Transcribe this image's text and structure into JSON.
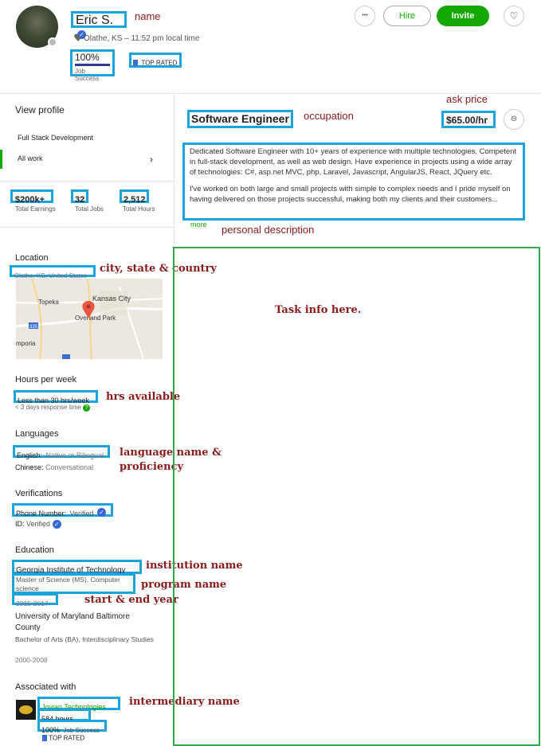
{
  "profile": {
    "name": "Eric S.",
    "location_time": "Olathe, KS – 11:52 pm local time",
    "job_success_value": "100%",
    "job_success_label": "Job Success",
    "job_success_fraction": 1.0,
    "badge": "TOP RATED"
  },
  "actions": {
    "more": "•••",
    "hire": "Hire",
    "invite": "Invite"
  },
  "sidebar": {
    "view_profile": "View profile",
    "specialty": "Full Stack Development",
    "all_work": "All work",
    "stats": [
      {
        "value": "$200k+",
        "label": "Total Earnings"
      },
      {
        "value": "32",
        "label": "Total Jobs"
      },
      {
        "value": "2,512",
        "label": "Total Hours"
      }
    ],
    "location_title": "Location",
    "location_value": "Olathe, KS, United States",
    "map_labels": {
      "kansas_city": "Kansas City",
      "topeka": "Topeka",
      "overland_park": "Overland Park",
      "emporia": "mporia",
      "r335": "335",
      "r35": "35"
    },
    "hours_title": "Hours per week",
    "hours_value": "Less than 30 hrs/week",
    "response_time": "< 3 days response time",
    "languages_title": "Languages",
    "languages": [
      {
        "name": "English:",
        "level": "Native or Bilingual"
      },
      {
        "name": "Chinese:",
        "level": "Conversational"
      }
    ],
    "verifications_title": "Verifications",
    "verifications": [
      {
        "name": "Phone Number:",
        "status": "Verified"
      },
      {
        "name": "ID:",
        "status": "Verified"
      }
    ],
    "education_title": "Education",
    "education": [
      {
        "institution": "Georgia Institute of Technology",
        "program": "Master of Science (MS), Computer science",
        "years": "2015-2017"
      },
      {
        "institution": "University of Maryland Baltimore County",
        "program": "Bachelor of Arts (BA), Interdisciplinary Studies",
        "years": "2000-2008"
      }
    ],
    "associated_title": "Associated with",
    "agency": {
      "name": "Jovian Technologies",
      "hours": "584 hours",
      "success_value": "100%",
      "success_label": "Job Success",
      "badge": "TOP RATED"
    }
  },
  "main": {
    "occupation": "Software Engineer",
    "rate": "$65.00/hr",
    "description_p1": "Dedicated Software Engineer with 10+ years of experience with multiple technologies. Competent in full-stack development, as well as web design. Have experience in projects using a wide array of technologies: C#, asp.net MVC, php, Laravel, Javascript, AngularJS, React, JQuery etc.",
    "description_p2": "I've worked on both large and small projects with simple to complex needs and I pride myself on having delivered on those projects successful, making both my clients and their customers...",
    "more": "more",
    "task_info": "Task info here."
  },
  "annotations": {
    "name": "name",
    "ask_price": "ask price",
    "occupation": "occupation",
    "personal_description": "personal description",
    "city_state_country": "city, state & country",
    "hrs_available": "hrs available",
    "language_1": "language name &",
    "language_2": "proficiency",
    "institution_name": "institution name",
    "program_name": "program name",
    "start_end_year": "start & end year",
    "intermediary_name": "intermediary name"
  },
  "colors": {
    "accent_green": "#14a800",
    "annotation_blue": "#1aa3dc",
    "annotation_red": "#8b1a1a",
    "task_box_green": "#2eaa4a"
  }
}
